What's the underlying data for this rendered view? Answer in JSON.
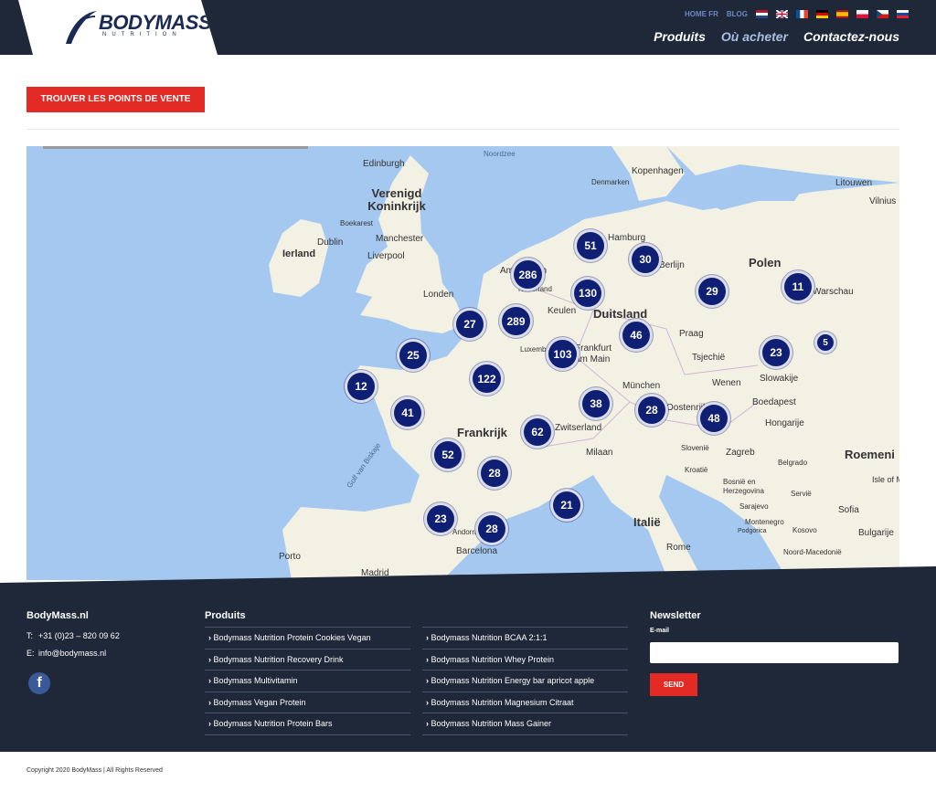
{
  "header": {
    "logo_text": "BODYMASS",
    "logo_sub": "NUTRITION",
    "top_links": [
      "HOME FR",
      "BLOG"
    ],
    "flags": [
      "nl-flag-icon",
      "uk-flag-icon",
      "fr-flag-icon",
      "de-flag-icon",
      "es-flag-icon",
      "pl-flag-icon",
      "cz-flag-icon",
      "sk-flag-icon"
    ],
    "nav": [
      {
        "label": "Produits",
        "active": false
      },
      {
        "label": "Où acheter",
        "active": true
      },
      {
        "label": "Contactez-nous",
        "active": false
      }
    ]
  },
  "cta_label": "TROUVER LES POINTS DE VENTE",
  "map": {
    "countries": [
      "Verenigd Koninkrijk",
      "Ierland",
      "Duitsland",
      "Polen",
      "Frankrijk",
      "Italië",
      "Roemeni"
    ],
    "cities": [
      "Edinburgh",
      "Dublin",
      "Manchester",
      "Liverpool",
      "Londen",
      "Kopenhagen",
      "Denmarken",
      "Hamburg",
      "Berlijn",
      "Amsterdam",
      "Nederland",
      "Keulen",
      "Luxemburg",
      "Frankfurt am Main",
      "Praag",
      "Tsjechië",
      "München",
      "Wenen",
      "Slowakije",
      "Boedapest",
      "Hongarije",
      "Oostenrijk",
      "Zwitserland",
      "Milaan",
      "Slovenië",
      "Zagreb",
      "Kroatië",
      "Belgrado",
      "Servië",
      "Bosnië en Herzegovina",
      "Sarajevo",
      "Montenegro",
      "Podgorica",
      "Kosovo",
      "Sofia",
      "Bulgarije",
      "Noord-Macedonië",
      "Rome",
      "Barcelona",
      "Madrid",
      "Porto",
      "Andorra",
      "Litouwen",
      "Vilnius",
      "Warschau",
      "Isle of Man",
      "Boekarest"
    ],
    "seas": [
      "Noordzee",
      "Golf van Biskaje"
    ],
    "clusters": [
      "51",
      "30",
      "286",
      "130",
      "29",
      "11",
      "289",
      "27",
      "46",
      "103",
      "5",
      "23",
      "25",
      "122",
      "12",
      "38",
      "28",
      "48",
      "41",
      "62",
      "52",
      "28",
      "21",
      "23",
      "28"
    ]
  },
  "footer": {
    "company": "BodyMass.nl",
    "phone_label": "T:",
    "phone": "+31 (0)23 – 820 09 62",
    "email_label": "E:",
    "email": "info@bodymass.nl",
    "products_heading": "Produits",
    "products_col1": [
      "Bodymass Nutrition Protein Cookies Vegan",
      "Bodymass Nutrition Recovery Drink",
      "Bodymass Multivitamin",
      "Bodymass Vegan Protein",
      "Bodymass Nutrition Protein Bars"
    ],
    "products_col2": [
      "Bodymass Nutrition BCAA 2:1:1",
      "Bodymass Nutrition Whey Protein",
      "Bodymass Nutrition Energy bar apricot apple",
      "Bodymass Nutrition Magnesium Citraat",
      "Bodymass Nutrition Mass Gainer"
    ],
    "newsletter_heading": "Newsletter",
    "email_field_label": "E-mail",
    "email_field_value": "",
    "send_label": "SEND"
  },
  "copyright": "Copyright 2020 BodyMass | All Rights Reserved"
}
